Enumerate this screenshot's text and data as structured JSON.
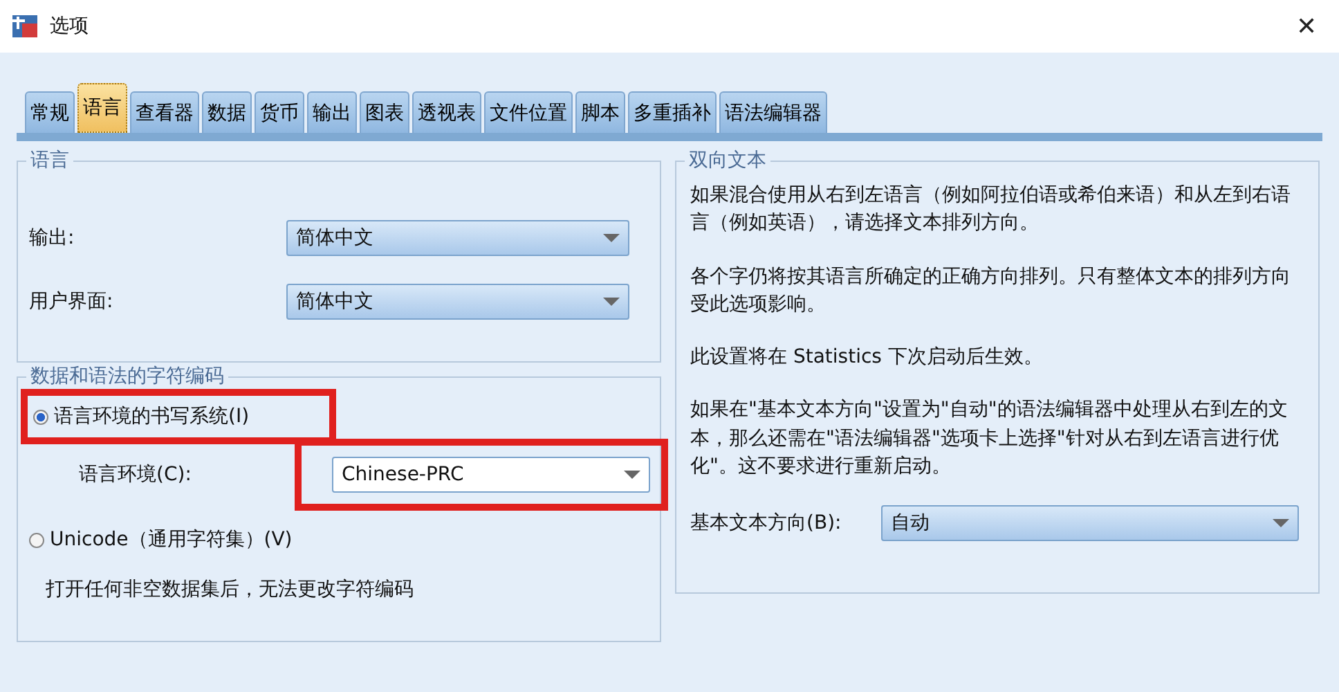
{
  "window": {
    "title": "选项",
    "close": "✕"
  },
  "tabs": [
    {
      "label": "常规",
      "selected": false
    },
    {
      "label": "语言",
      "selected": true
    },
    {
      "label": "查看器",
      "selected": false
    },
    {
      "label": "数据",
      "selected": false
    },
    {
      "label": "货币",
      "selected": false
    },
    {
      "label": "输出",
      "selected": false
    },
    {
      "label": "图表",
      "selected": false
    },
    {
      "label": "透视表",
      "selected": false
    },
    {
      "label": "文件位置",
      "selected": false
    },
    {
      "label": "脚本",
      "selected": false
    },
    {
      "label": "多重插补",
      "selected": false
    },
    {
      "label": "语法编辑器",
      "selected": false
    }
  ],
  "language_group": {
    "title": "语言",
    "fields": [
      {
        "label": "输出:",
        "value": "简体中文"
      },
      {
        "label": "用户界面:",
        "value": "简体中文"
      }
    ]
  },
  "encoding_group": {
    "title": "数据和语法的字符编码",
    "options": [
      {
        "label": "语言环境的书写系统(I)",
        "selected": true,
        "highlighted": true
      },
      {
        "label": "Unicode（通用字符集）(V)",
        "selected": false,
        "highlighted": false
      }
    ],
    "locale_field": {
      "label": "语言环境(C):",
      "value": "Chinese-PRC",
      "highlighted": true
    },
    "note": "打开任何非空数据集后，无法更改字符编码"
  },
  "bidi_group": {
    "title": "双向文本",
    "paragraphs": [
      "如果混合使用从右到左语言（例如阿拉伯语或希伯来语）和从左到右语言（例如英语），请选择文本排列方向。",
      "各个字仍将按其语言所确定的正确方向排列。只有整体文本的排列方向受此选项影响。",
      "此设置将在 Statistics 下次启动后生效。",
      "如果在\"基本文本方向\"设置为\"自动\"的语法编辑器中处理从右到左的文本，那么还需在\"语法编辑器\"选项卡上选择\"针对从右到左语言进行优化\"。这不要求进行重新启动。"
    ],
    "direction_field": {
      "label": "基本文本方向(B):",
      "value": "自动"
    }
  }
}
